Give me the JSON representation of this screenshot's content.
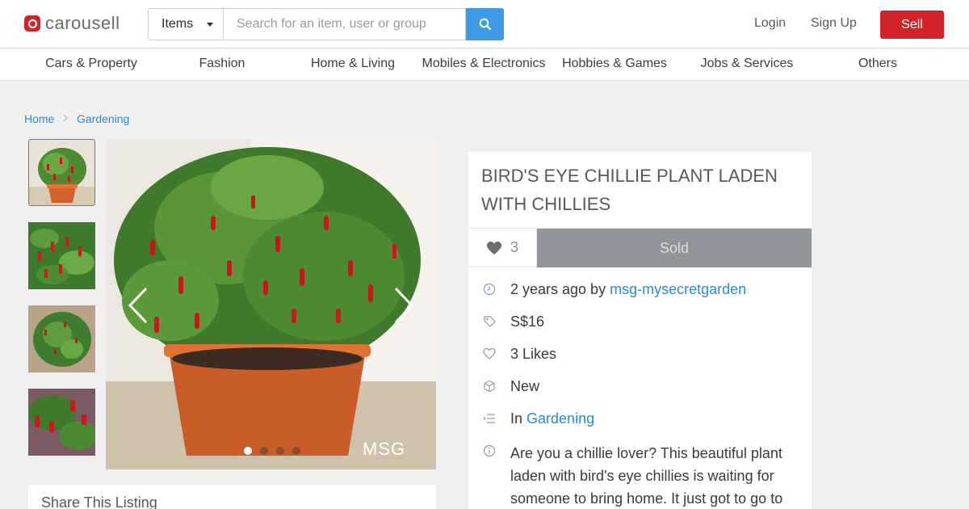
{
  "header": {
    "logo_text": "carousell",
    "search_type": "Items",
    "search_placeholder": "Search for an item, user or group",
    "login": "Login",
    "signup": "Sign Up",
    "sell": "Sell"
  },
  "categories": [
    "Cars & Property",
    "Fashion",
    "Home & Living",
    "Mobiles & Electronics",
    "Hobbies & Games",
    "Jobs & Services",
    "Others"
  ],
  "breadcrumb": {
    "home": "Home",
    "current": "Gardening"
  },
  "gallery": {
    "watermark": "MSG",
    "slides": 4,
    "active_slide": 1
  },
  "share": {
    "title": "Share This Listing"
  },
  "listing": {
    "title": "BIRD'S EYE CHILLIE PLANT LADEN WITH CHILLIES",
    "like_count": "3",
    "status": "Sold",
    "posted": "2 years ago by",
    "seller": "msg-mysecretgarden",
    "price": "S$16",
    "likes": "3 Likes",
    "condition": "New",
    "category_prefix": "In",
    "category": "Gardening",
    "description": "Are you a chillie lover?  This beautiful plant laden with bird's eye chillies is waiting for someone to bring home.  It just got to go to"
  },
  "colors": {
    "brand": "#d2232a",
    "accent": "#3d9ae8",
    "link": "#2b8ad3",
    "sold": "#8f959b"
  }
}
